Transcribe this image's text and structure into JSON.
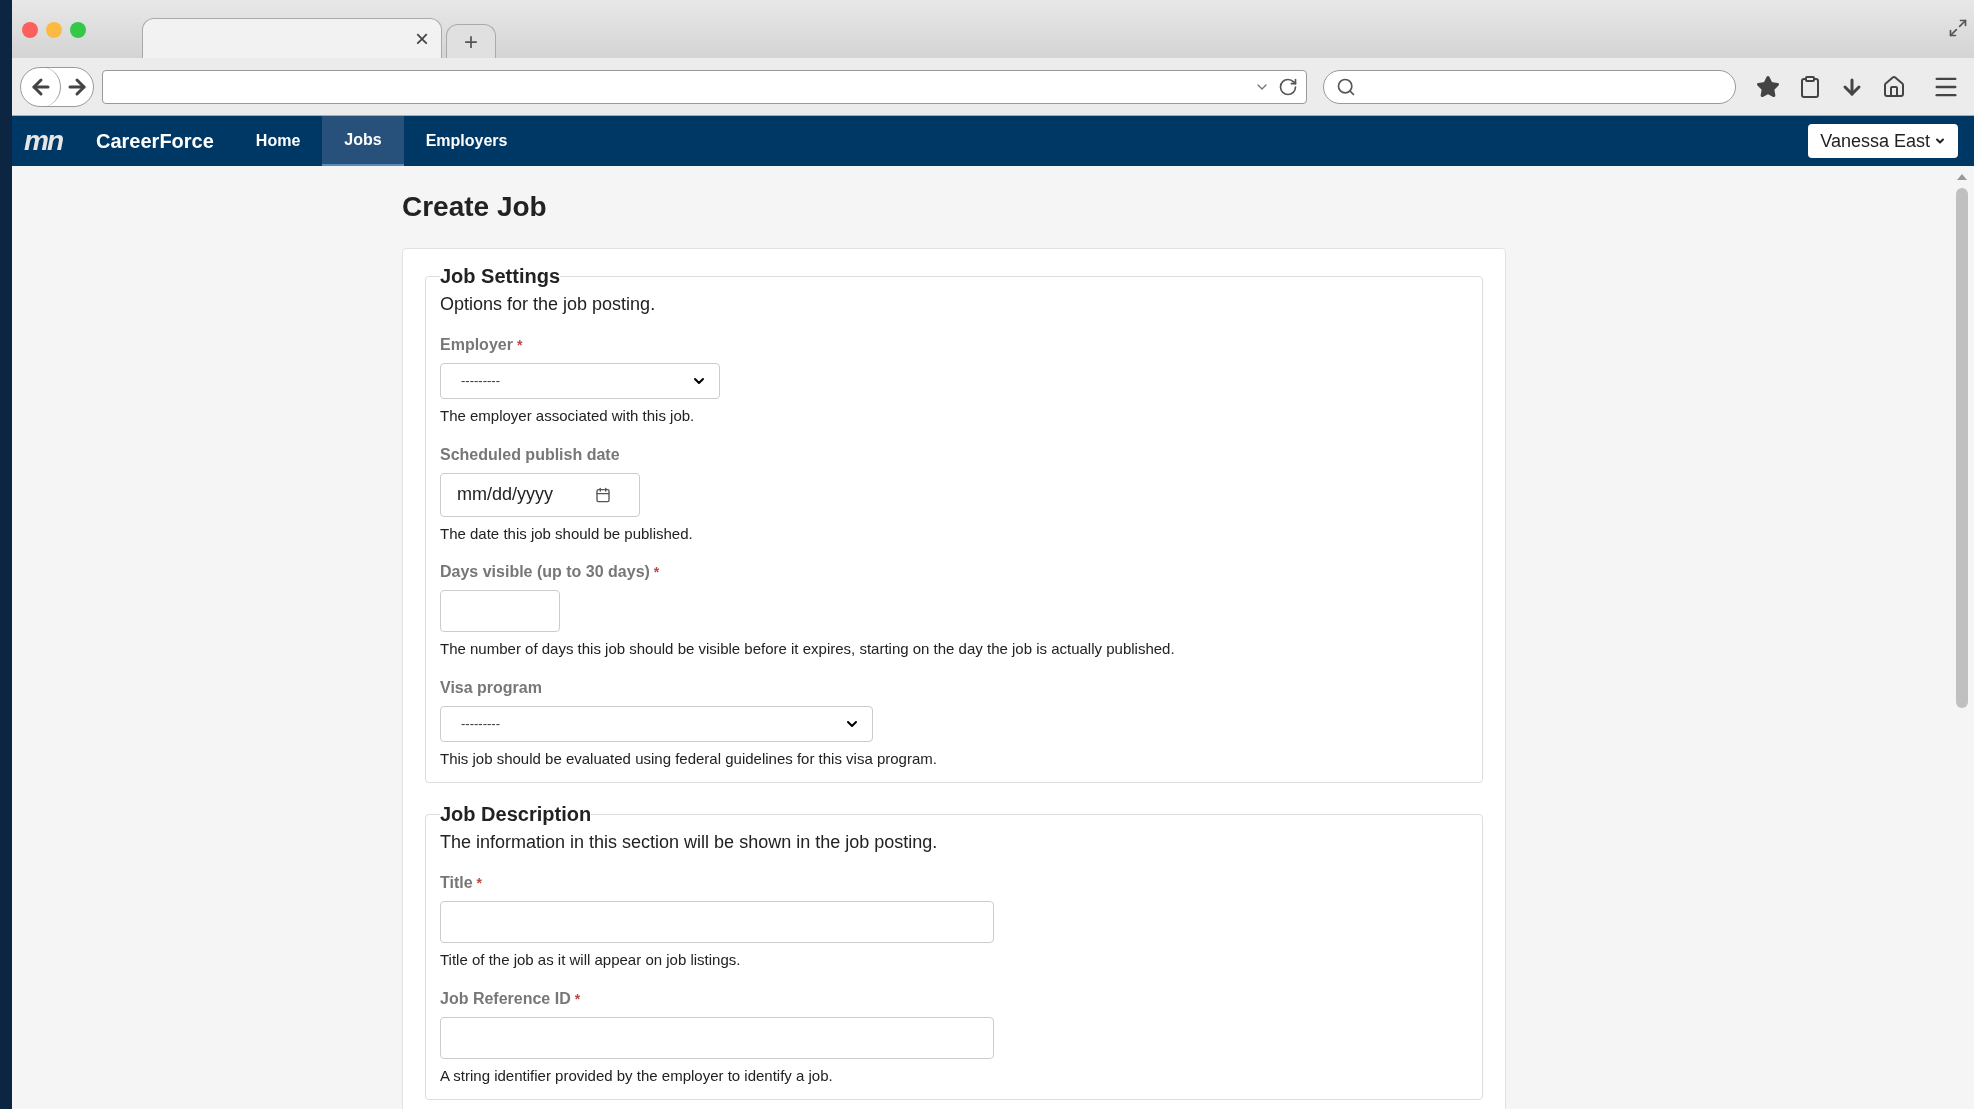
{
  "browser": {
    "tab_close": "×",
    "new_tab": "+"
  },
  "navbar": {
    "logo": "mn",
    "brand": "CareerForce",
    "items": [
      {
        "label": "Home",
        "selected": false
      },
      {
        "label": "Jobs",
        "selected": true
      },
      {
        "label": "Employers",
        "selected": false
      }
    ],
    "user": "Vanessa East"
  },
  "page": {
    "title": "Create Job",
    "required_marker": "*"
  },
  "sections": [
    {
      "legend": "Job Settings",
      "description": "Options for the job posting.",
      "fields": [
        {
          "kind": "select",
          "label": "Employer",
          "required": true,
          "value": "---------",
          "help": "The employer associated with this job."
        },
        {
          "kind": "date",
          "label": "Scheduled publish date",
          "required": false,
          "placeholder": "mm/dd/yyyy",
          "help": "The date this job should be published."
        },
        {
          "kind": "text",
          "label": "Days visible (up to 30 days)",
          "required": true,
          "help": "The number of days this job should be visible before it expires, starting on the day the job is actually published."
        },
        {
          "kind": "select",
          "label": "Visa program",
          "required": false,
          "value": "---------",
          "help": "This job should be evaluated using federal guidelines for this visa program."
        }
      ]
    },
    {
      "legend": "Job Description",
      "description": "The information in this section will be shown in the job posting.",
      "fields": [
        {
          "kind": "text",
          "label": "Title",
          "required": true,
          "help": "Title of the job as it will appear on job listings."
        },
        {
          "kind": "text",
          "label": "Job Reference ID",
          "required": true,
          "help": "A string identifier provided by the employer to identify a job."
        }
      ]
    }
  ]
}
